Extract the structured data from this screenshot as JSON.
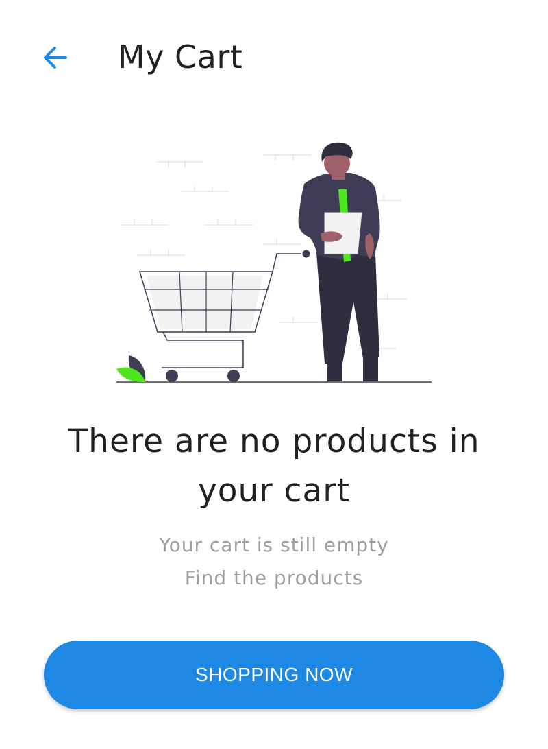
{
  "header": {
    "title": "My Cart",
    "back_icon": "arrow-left-icon",
    "accent_color": "#1e88e5"
  },
  "empty_state": {
    "illustration": "person-with-shopping-cart-illustration",
    "title": "There are no products in your cart",
    "subtitle_line1": "Your cart is still empty",
    "subtitle_line2": "Find the products"
  },
  "actions": {
    "shop_button_label": "SHOPPING NOW",
    "button_color": "#1e88e5"
  }
}
